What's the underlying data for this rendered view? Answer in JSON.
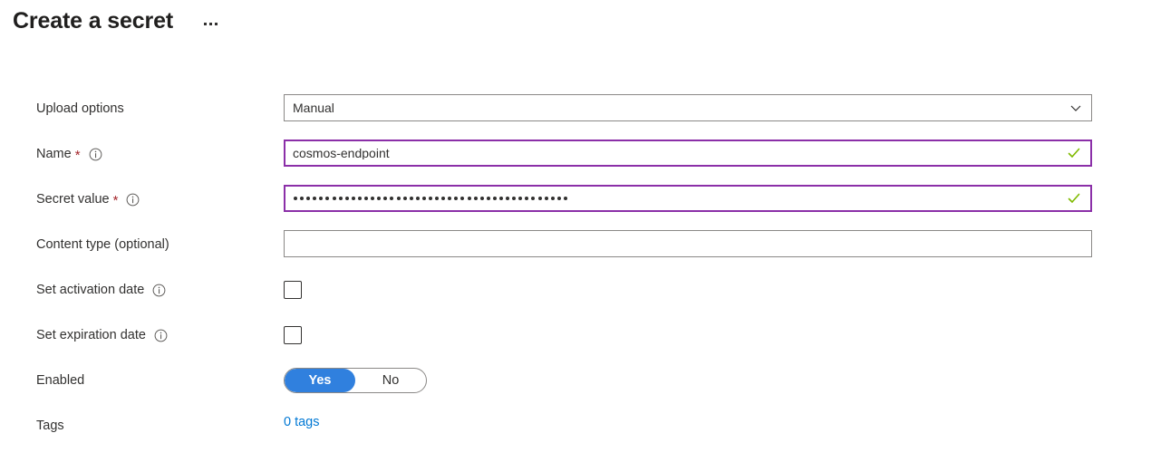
{
  "header": {
    "title": "Create a secret",
    "more_menu_label": "..."
  },
  "form": {
    "upload_options": {
      "label": "Upload options",
      "value": "Manual",
      "icon": "chevron-down-icon"
    },
    "name": {
      "label": "Name",
      "required_marker": "*",
      "info_icon": "info-icon",
      "value": "cosmos-endpoint",
      "state_icon": "checkmark-icon",
      "state": "valid"
    },
    "secret_value": {
      "label": "Secret value",
      "required_marker": "*",
      "info_icon": "info-icon",
      "value": "••••••••••••••••••••••••••••••••••••••••••••",
      "masked_char_count": 43,
      "state_icon": "checkmark-icon",
      "state": "valid"
    },
    "content_type": {
      "label": "Content type (optional)",
      "value": "",
      "placeholder": ""
    },
    "set_activation_date": {
      "label": "Set activation date",
      "info_icon": "info-icon",
      "checked": false
    },
    "set_expiration_date": {
      "label": "Set expiration date",
      "info_icon": "info-icon",
      "checked": false
    },
    "enabled": {
      "label": "Enabled",
      "options": [
        "Yes",
        "No"
      ],
      "selected": "Yes"
    },
    "tags": {
      "label": "Tags",
      "link_text": "0 tags"
    }
  },
  "colors": {
    "accent_blue": "#3080de",
    "link_blue": "#0078d4",
    "valid_green": "#7fba00",
    "focus_purple": "#8b2fa8",
    "required_red": "#a4262c",
    "border_gray": "#8a8886",
    "text_dark": "#323130"
  }
}
